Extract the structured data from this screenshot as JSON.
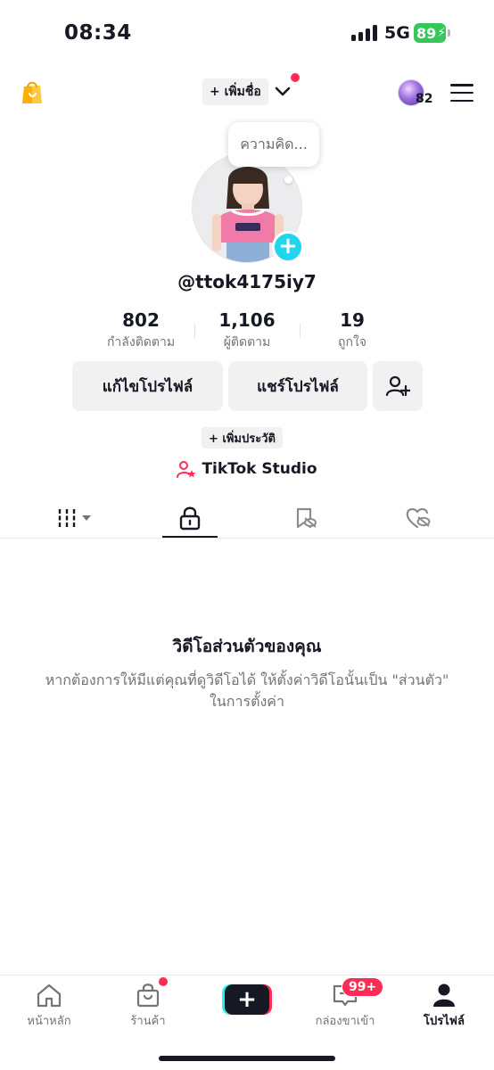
{
  "status_bar": {
    "time": "08:34",
    "network": "5G",
    "battery": "89",
    "battery_color": "#34c759"
  },
  "header": {
    "add_name_label": "+ เพิ่มชื่อ",
    "notification_count": "82",
    "icons": [
      "shop-bag-icon",
      "chevron-down-icon",
      "avatar-icon",
      "menu-icon"
    ]
  },
  "profile": {
    "thought_placeholder": "ความคิด...",
    "username": "@ttok4175iy7",
    "stats": [
      {
        "value": "802",
        "label": "กำลังติดตาม"
      },
      {
        "value": "1,106",
        "label": "ผู้ติดตาม"
      },
      {
        "value": "19",
        "label": "ถูกใจ"
      }
    ],
    "edit_profile_label": "แก้ไขโปรไฟล์",
    "share_profile_label": "แชร์โปรไฟล์",
    "add_bio_label": "+ เพิ่มประวัติ",
    "studio_label": "TikTok Studio"
  },
  "tabs": {
    "items": [
      "grid-filter-icon",
      "lock-icon",
      "repost-hidden-icon",
      "liked-hidden-icon"
    ],
    "active_index": 1
  },
  "empty_state": {
    "title": "วิดีโอส่วนตัวของคุณ",
    "description": "หากต้องการให้มีแต่คุณที่ดูวิดีโอได้ ให้ตั้งค่าวิดีโอนั้นเป็น \"ส่วนตัว\" ในการตั้งค่า"
  },
  "bottom_nav": {
    "items": [
      {
        "label": "หน้าหลัก",
        "icon": "home-icon"
      },
      {
        "label": "ร้านค้า",
        "icon": "shop-icon"
      },
      {
        "label": "",
        "icon": "create-icon"
      },
      {
        "label": "กล่องขาเข้า",
        "icon": "inbox-icon"
      },
      {
        "label": "โปรไฟล์",
        "icon": "profile-icon"
      }
    ],
    "inbox_badge": "99+",
    "active": "โปรไฟล์",
    "accent_red": "#fe2c55",
    "accent_cyan": "#25f4ee"
  }
}
